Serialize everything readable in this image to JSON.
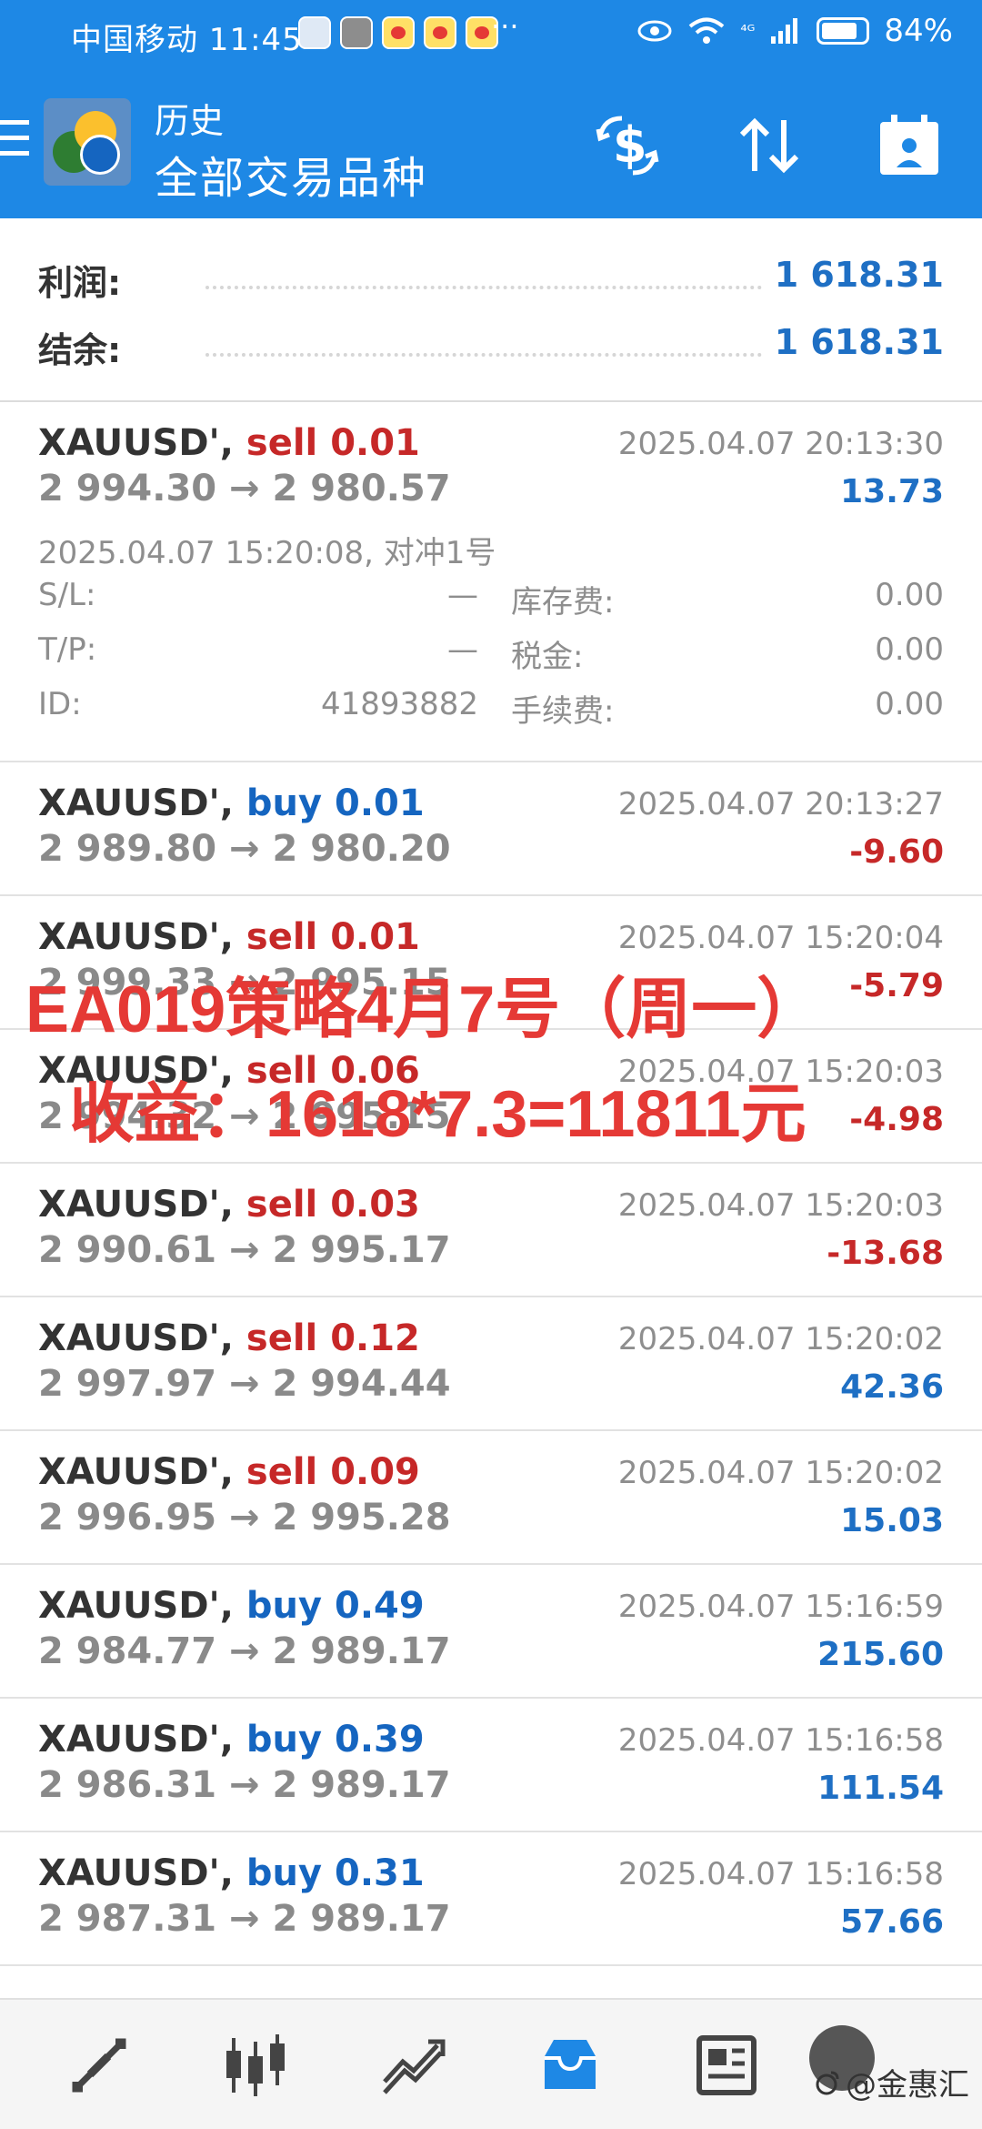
{
  "status_bar": {
    "carrier_time": "中国移动 11:45",
    "dots": "···",
    "network": "⁴ᴳ",
    "battery": "84%"
  },
  "toolbar": {
    "title": "历史",
    "subtitle": "全部交易品种",
    "icons": [
      "menu-icon",
      "dollar-exchange-icon",
      "sort-icon",
      "calendar-icon"
    ]
  },
  "summary": {
    "profit_label": "利润:",
    "profit_value": "1 618.31",
    "balance_label": "结余:",
    "balance_value": "1 618.31"
  },
  "expanded_deal": {
    "symbol": "XAUUSD', ",
    "type": "sell 0.01",
    "prices": "2 994.30 → 2 980.57",
    "close_time": "2025.04.07 20:13:30",
    "profit": "13.73",
    "open_info": "2025.04.07 15:20:08, 对冲1号",
    "sl_label": "S/L:",
    "sl_value": "—",
    "swap_label": "库存费:",
    "swap_value": "0.00",
    "tp_label": "T/P:",
    "tp_value": "—",
    "tax_label": "税金:",
    "tax_value": "0.00",
    "id_label": "ID:",
    "id_value": "41893882",
    "fee_label": "手续费:",
    "fee_value": "0.00"
  },
  "deals": [
    {
      "symbol": "XAUUSD', ",
      "type": "buy 0.01",
      "prices": "2 989.80 → 2 980.20",
      "time": "2025.04.07 20:13:27",
      "profit": "-9.60"
    },
    {
      "symbol": "XAUUSD', ",
      "type": "sell 0.01",
      "prices": "2 999.33 → 2 995.15",
      "time": "2025.04.07 15:20:04",
      "profit": "-5.79"
    },
    {
      "symbol": "XAUUSD', ",
      "type": "sell 0.06",
      "prices": "2 994.32 → 2 995.15",
      "time": "2025.04.07 15:20:03",
      "profit": "-4.98"
    },
    {
      "symbol": "XAUUSD', ",
      "type": "sell 0.03",
      "prices": "2 990.61 → 2 995.17",
      "time": "2025.04.07 15:20:03",
      "profit": "-13.68"
    },
    {
      "symbol": "XAUUSD', ",
      "type": "sell 0.12",
      "prices": "2 997.97 → 2 994.44",
      "time": "2025.04.07 15:20:02",
      "profit": "42.36"
    },
    {
      "symbol": "XAUUSD', ",
      "type": "sell 0.09",
      "prices": "2 996.95 → 2 995.28",
      "time": "2025.04.07 15:20:02",
      "profit": "15.03"
    },
    {
      "symbol": "XAUUSD', ",
      "type": "buy 0.49",
      "prices": "2 984.77 → 2 989.17",
      "time": "2025.04.07 15:16:59",
      "profit": "215.60"
    },
    {
      "symbol": "XAUUSD', ",
      "type": "buy 0.39",
      "prices": "2 986.31 → 2 989.17",
      "time": "2025.04.07 15:16:58",
      "profit": "111.54"
    },
    {
      "symbol": "XAUUSD', ",
      "type": "buy 0.31",
      "prices": "2 987.31 → 2 989.17",
      "time": "2025.04.07 15:16:58",
      "profit": "57.66"
    }
  ],
  "overlay": {
    "line1": "EA019策略4月7号（周一）",
    "line2": "收益：1618*7.3=11811元"
  },
  "bottom_nav": {
    "items": [
      "quotes-icon",
      "chart-candles-icon",
      "trade-icon",
      "history-icon",
      "news-icon"
    ],
    "watermark": "@金惠汇"
  },
  "colors": {
    "primary": "#1e88e5",
    "profit_positive": "#1e6fc4",
    "profit_negative": "#c62828",
    "overlay_red": "#e53935"
  }
}
